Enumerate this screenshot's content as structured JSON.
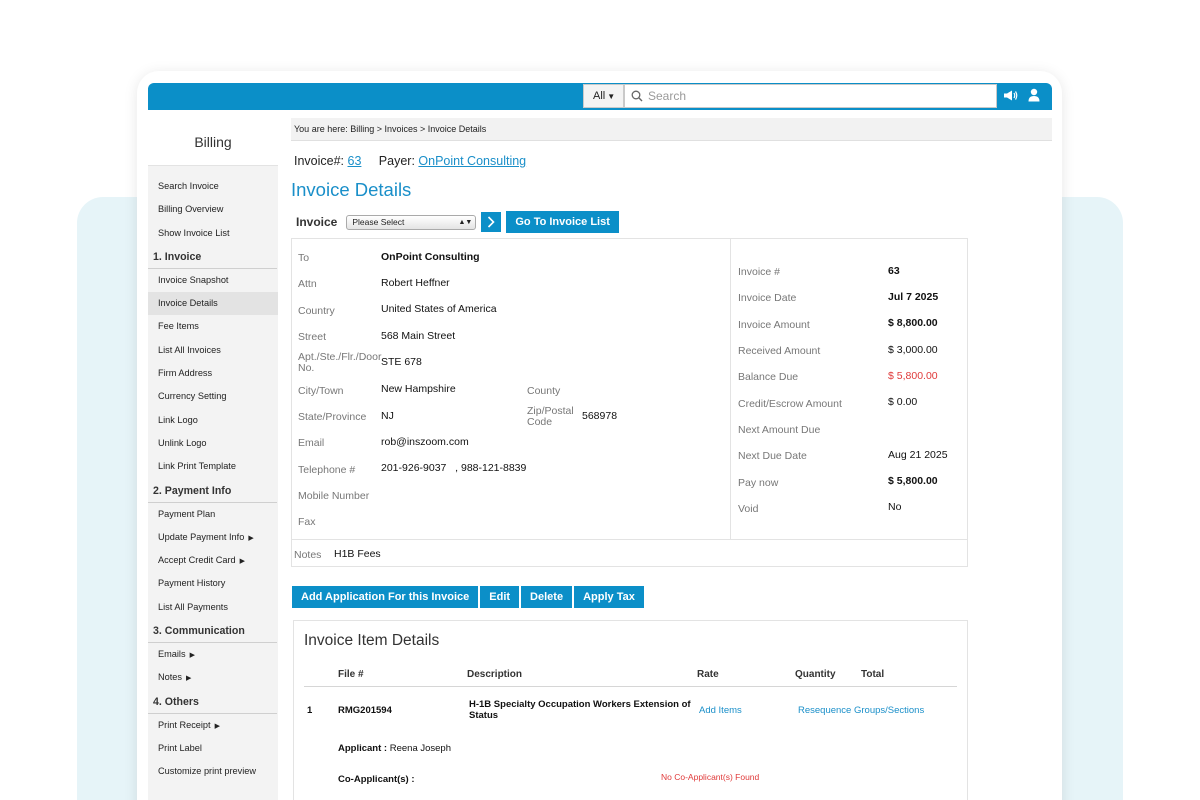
{
  "topbar": {
    "search_category": "All",
    "search_placeholder": "Search",
    "announce_icon": "megaphone-icon",
    "user_icon": "user-icon"
  },
  "sidebar": {
    "title": "Billing",
    "top_items": [
      "Search Invoice",
      "Billing Overview",
      "Show Invoice List"
    ],
    "sections": [
      {
        "title": "1. Invoice",
        "items": [
          {
            "label": "Invoice Snapshot",
            "arrow": false
          },
          {
            "label": "Invoice Details",
            "arrow": false,
            "active": true
          },
          {
            "label": "Fee Items",
            "arrow": false
          },
          {
            "label": "List All Invoices",
            "arrow": false
          },
          {
            "label": "Firm Address",
            "arrow": false
          },
          {
            "label": "Currency Setting",
            "arrow": false
          },
          {
            "label": "Link Logo",
            "arrow": false
          },
          {
            "label": "Unlink Logo",
            "arrow": false
          },
          {
            "label": "Link Print Template",
            "arrow": false
          }
        ]
      },
      {
        "title": "2. Payment Info",
        "items": [
          {
            "label": "Payment Plan",
            "arrow": false
          },
          {
            "label": "Update Payment Info",
            "arrow": true
          },
          {
            "label": "Accept Credit Card",
            "arrow": true
          },
          {
            "label": "Payment History",
            "arrow": false
          },
          {
            "label": "List All Payments",
            "arrow": false
          }
        ]
      },
      {
        "title": "3. Communication",
        "items": [
          {
            "label": "Emails",
            "arrow": true
          },
          {
            "label": "Notes",
            "arrow": true
          }
        ]
      },
      {
        "title": "4. Others",
        "items": [
          {
            "label": "Print Receipt",
            "arrow": true
          },
          {
            "label": "Print Label",
            "arrow": false
          },
          {
            "label": "Customize print preview",
            "arrow": false
          }
        ]
      }
    ]
  },
  "breadcrumb": "You are here:  Billing > Invoices > Invoice Details",
  "invoice_header": {
    "invoice_label": "Invoice#:",
    "invoice_number": "63",
    "payer_label": "Payer:",
    "payer_name": "OnPoint Consulting"
  },
  "page_title": "Invoice Details",
  "invoice_selector": {
    "label": "Invoice",
    "select_value": "Please Select",
    "goto_label": "Go To Invoice List"
  },
  "details": {
    "to_label": "To",
    "to_value": "OnPoint Consulting",
    "attn_label": "Attn",
    "attn_value": "Robert Heffner",
    "country_label": "Country",
    "country_value": "United States of America",
    "street_label": "Street",
    "street_value": "568 Main Street",
    "apt_label": "Apt./Ste./Flr./Door No.",
    "apt_value": "STE 678",
    "city_label": "City/Town",
    "city_value": "New Hampshire",
    "county_label": "County",
    "county_value": "",
    "state_label": "State/Province",
    "state_value": "NJ",
    "zip_label": "Zip/Postal Code",
    "zip_value": "568978",
    "email_label": "Email",
    "email_value": "rob@inszoom.com",
    "tel_label": "Telephone #",
    "tel_value": "201-926-9037   , 988-121-8839",
    "mobile_label": "Mobile Number",
    "mobile_value": "",
    "fax_label": "Fax",
    "fax_value": "",
    "notes_label": "Notes",
    "notes_value": "H1B Fees"
  },
  "summary": [
    {
      "label": "Invoice #",
      "value": "63",
      "style": "b"
    },
    {
      "label": "Invoice Date",
      "value": "Jul 7 2025",
      "style": "b"
    },
    {
      "label": "Invoice Amount",
      "value": "$ 8,800.00",
      "style": "b"
    },
    {
      "label": "Received Amount",
      "value": "$ 3,000.00",
      "style": ""
    },
    {
      "label": "Balance Due",
      "value": "$ 5,800.00",
      "style": "red"
    },
    {
      "label": "Credit/Escrow Amount",
      "value": "$ 0.00",
      "style": ""
    },
    {
      "label": "Next Amount Due",
      "value": "",
      "style": ""
    },
    {
      "label": "Next Due Date",
      "value": "Aug 21 2025",
      "style": ""
    },
    {
      "label": "Pay now",
      "value": "$ 5,800.00",
      "style": "b"
    },
    {
      "label": "Void",
      "value": "No",
      "style": ""
    }
  ],
  "actions": {
    "add_app": "Add Application For this Invoice",
    "edit": "Edit",
    "delete": "Delete",
    "apply_tax": "Apply Tax"
  },
  "items": {
    "title": "Invoice Item Details",
    "headers": {
      "file": "File #",
      "description": "Description",
      "rate": "Rate",
      "quantity": "Quantity",
      "total": "Total"
    },
    "row": {
      "index": "1",
      "file": "RMG201594",
      "description": "H-1B Specialty Occupation Workers Extension of Status",
      "add_items": "Add Items",
      "resequence": "Resequence Groups/Sections",
      "applicant_label": "Applicant :",
      "applicant_value": "Reena Joseph",
      "co_applicant_label": "Co-Applicant(s) :",
      "co_applicant_value": "No Co-Applicant(s) Found"
    }
  }
}
